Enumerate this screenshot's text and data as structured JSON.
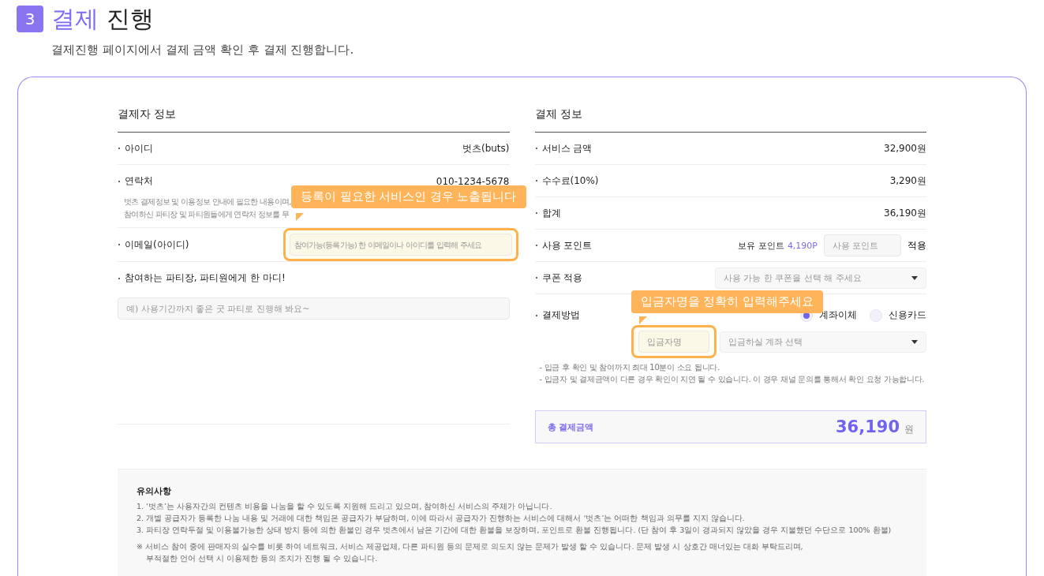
{
  "header": {
    "step": "3",
    "title_accent": "결제",
    "title_rest": "진행",
    "subtitle": "결제진행 페이지에서 결제 금액 확인 후 결제 진행합니다."
  },
  "payer": {
    "title": "결제자 정보",
    "rows": [
      {
        "kind": "value",
        "label": "아이디",
        "value": "벗츠(buts)"
      },
      {
        "kind": "contact",
        "label": "연락처",
        "value": "010-1234-5678",
        "notes": [
          "벗츠 결제정보 및 이용정보 안내에 필요한 내용이며,",
          "참여하신 파티장 및 파티원들에게 연락처 정보를 무"
        ]
      },
      {
        "kind": "email",
        "label": "이메일(아이디)",
        "placeholder": "참여가능(등록가능) 한 이메일이나 아이디를 입력해 주세요",
        "tooltip": "등록이 필요한 서비스인 경우 노출됩니다"
      },
      {
        "kind": "message",
        "label": "참여하는 파티장, 파티원에게 한 마디!",
        "placeholder": "예) 사용기간까지 좋은 굿 파티로 진행해 봐요~"
      }
    ]
  },
  "payment": {
    "title": "결제 정보",
    "rows": [
      {
        "kind": "value",
        "label": "서비스 금액",
        "value": "32,900원"
      },
      {
        "kind": "value",
        "label": "수수료(10%)",
        "value": "3,290원"
      },
      {
        "kind": "value",
        "label": "합계",
        "value": "36,190원"
      },
      {
        "kind": "points",
        "label": "사용 포인트",
        "owned_label": "보유 포인트",
        "owned": "4,190P",
        "placeholder": "사용 포인트",
        "apply": "적용"
      },
      {
        "kind": "coupon",
        "label": "쿠폰 적용",
        "placeholder": "사용 가능 한 쿠폰을 선택 해 주세요"
      },
      {
        "kind": "method",
        "label": "결제방법",
        "options": [
          {
            "label": "계좌이체",
            "selected": true
          },
          {
            "label": "신용카드",
            "selected": false
          }
        ],
        "depositor_placeholder": "입금자명",
        "account_placeholder": "입금하실 계좌 선택",
        "tooltip": "입금자명을 정확히 입력해주세요",
        "notes": [
          "- 입금 후 확인 및 참여까지 최대 10분이 소요 됩니다.",
          "- 입금자 및 결제금액이 다른 경우 확인이 지연 될 수 있습니다. 이 경우 채널 문의를 통해서 확인 요청 가능합니다."
        ]
      }
    ],
    "total": {
      "label": "총 결제금액",
      "amount": "36,190",
      "unit": "원"
    }
  },
  "notice": {
    "title": "유의사항",
    "items": [
      "1. ‘벗츠’는 사용자간의 컨텐츠 비용을 나눔을 할 수 있도록 지원해 드리고 있으며, 참여하신 서비스의 주체가 아닙니다.",
      "2. 개별 공급자가 등록한 나눔 내용 및 거래에 대한 책임은 공급자가 부담하며, 이에 따라서 공급자가 진행하는 서비스에 대해서 ‘벗츠’는 어떠한 책임과 의무를 지지 않습니다.",
      "3. 파티장 연락두절 및 이용불가능한 상태 방치 등에 의한 환불인 경우 벗츠에서 남은 기간에 대한 환불을 보장하며, 포인트로 환불 진행됩니다. (단 참여 후 3일이 경과되지 않았을 경우 지불했던 수단으로 100% 환불)"
    ],
    "remark": [
      "※ 서비스 참여 중에 판매자의 실수를 비롯 하여 네트워크, 서비스 제공업체, 다른 파티원 등의 문제로 의도치 않는 문제가 발생 할 수 있습니다. 문제 발생 시 상호간 매너있는 대화 부탁드리며,",
      "부적절한 언어 선택 시 이용제한 등의 조치가 진행 될 수 있습니다."
    ]
  }
}
